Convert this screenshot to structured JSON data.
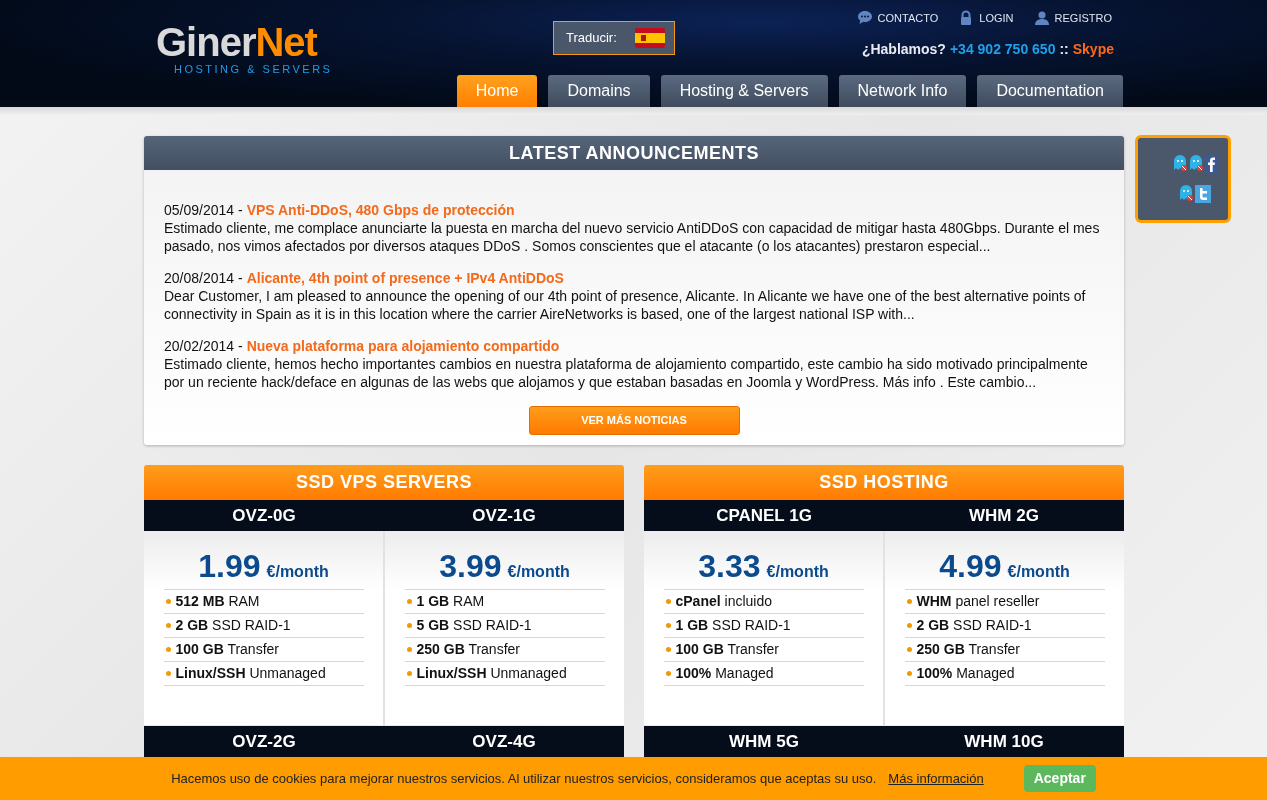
{
  "header": {
    "logo": {
      "part1": "Giner",
      "part2": "Net",
      "tagline": "HOSTING & SERVERS"
    },
    "translate": {
      "label": "Traducir:"
    },
    "top_links": [
      {
        "kind": "chat",
        "label": "CONTACTO"
      },
      {
        "kind": "lock",
        "label": "LOGIN"
      },
      {
        "kind": "user",
        "label": "REGISTRO"
      }
    ],
    "contact": {
      "prompt": "¿Hablamos?",
      "phone": "+34 902 750 650",
      "separator": "::",
      "skype": "Skype"
    },
    "nav": [
      {
        "label": "Home",
        "selected": true
      },
      {
        "label": "Domains",
        "selected": false
      },
      {
        "label": "Hosting & Servers",
        "selected": false
      },
      {
        "label": "Network Info",
        "selected": false
      },
      {
        "label": "Documentation",
        "selected": false
      }
    ]
  },
  "announcements": {
    "title": "LATEST ANNOUNCEMENTS",
    "items": [
      {
        "date": "05/09/2014 -",
        "title": "VPS Anti-DDoS, 480 Gbps de protección",
        "body": "Estimado cliente, me complace anunciarte la puesta en marcha del nuevo servicio AntiDDoS con capacidad de mitigar hasta 480Gbps. Durante el mes pasado, nos vimos afectados por diversos ataques DDoS . Somos conscientes que el atacante (o los atacantes) prestaron especial..."
      },
      {
        "date": "20/08/2014 -",
        "title": "Alicante, 4th point of presence + IPv4 AntiDDoS",
        "body": "Dear Customer, I am pleased to announce the opening of our 4th point of presence, Alicante. In Alicante we have one of the best alternative points of connectivity in Spain as it is in this location where the carrier AireNetworks is based, one of the largest national ISP with..."
      },
      {
        "date": "20/02/2014 -",
        "title": "Nueva plataforma para alojamiento compartido",
        "body": "Estimado cliente, hemos hecho importantes cambios en nuestra plataforma de alojamiento compartido, este cambio ha sido motivado principalmente por un reciente hack/deface en algunas de las webs que alojamos y que estaban basadas en Joomla y WordPress. Más info . Este cambio..."
      }
    ],
    "more_button": "VER MÁS NOTICIAS"
  },
  "social": [
    {
      "kind": "facebook"
    },
    {
      "kind": "twitter"
    }
  ],
  "sections": [
    {
      "title": "SSD VPS SERVERS",
      "plans": [
        {
          "name": "OVZ-0G",
          "price": "1.99",
          "unit": "€/month",
          "features": [
            "**512 MB** RAM",
            "**2 GB** SSD RAID-1",
            "**100 GB** Transfer",
            "**Linux/SSH** Unmanaged"
          ]
        },
        {
          "name": "OVZ-1G",
          "price": "3.99",
          "unit": "€/month",
          "features": [
            "**1 GB** RAM",
            "**5 GB** SSD RAID-1",
            "**250 GB** Transfer",
            "**Linux/SSH** Unmanaged"
          ]
        }
      ],
      "next_plans": [
        "OVZ-2G",
        "OVZ-4G"
      ]
    },
    {
      "title": "SSD HOSTING",
      "plans": [
        {
          "name": "CPANEL 1G",
          "price": "3.33",
          "unit": "€/month",
          "features": [
            "**cPanel** incluido",
            "**1 GB** SSD RAID-1",
            "**100 GB** Transfer",
            "**100%** Managed"
          ]
        },
        {
          "name": "WHM 2G",
          "price": "4.99",
          "unit": "€/month",
          "features": [
            "**WHM** panel reseller",
            "**2 GB** SSD RAID-1",
            "**250 GB** Transfer",
            "**100%** Managed"
          ]
        }
      ],
      "next_plans": [
        "WHM 5G",
        "WHM 10G"
      ]
    }
  ],
  "cookie_bar": {
    "text": "Hacemos uso de cookies para mejorar nuestros servicios. Al utilizar nuestros servicios, consideramos que aceptas su uso.",
    "link": "Más información",
    "button": "Aceptar"
  }
}
